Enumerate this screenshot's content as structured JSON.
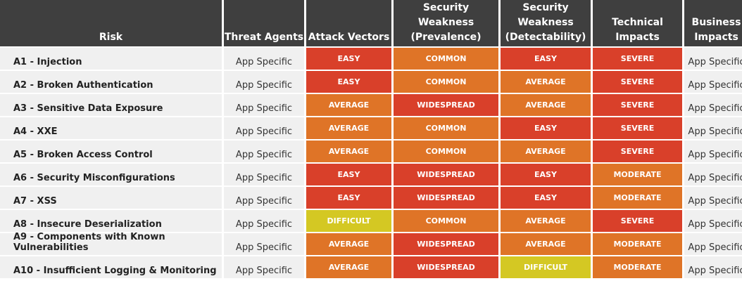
{
  "header": {
    "risk": "Risk",
    "threat_agents": "Threat Agents",
    "attack_vectors": "Attack Vectors",
    "prevalence_line1": "Security Weakness",
    "prevalence_line2": "(Prevalence)",
    "detectability_line1": "Security",
    "detectability_line2": "Weakness",
    "detectability_line3": "(Detectability)",
    "technical_line1": "Technical",
    "technical_line2": "Impacts",
    "business_line1": "Business",
    "business_line2": "Impacts"
  },
  "colors": {
    "red": "#d9402a",
    "orange": "#df7427",
    "yellow": "#d4c823",
    "header_bg": "#3f3f3f",
    "row_bg": "#f0f0f0"
  },
  "rows": [
    {
      "risk": "A1 - Injection",
      "threat": "App Specific",
      "attack": "EASY",
      "prevalence": "COMMON",
      "detectability": "EASY",
      "technical": "SEVERE",
      "business": "App Specific"
    },
    {
      "risk": "A2 - Broken Authentication",
      "threat": "App Specific",
      "attack": "EASY",
      "prevalence": "COMMON",
      "detectability": "AVERAGE",
      "technical": "SEVERE",
      "business": "App Specific"
    },
    {
      "risk": "A3 - Sensitive Data Exposure",
      "threat": "App Specific",
      "attack": "AVERAGE",
      "prevalence": "WIDESPREAD",
      "detectability": "AVERAGE",
      "technical": "SEVERE",
      "business": "App Specific"
    },
    {
      "risk": "A4 - XXE",
      "threat": "App Specific",
      "attack": "AVERAGE",
      "prevalence": "COMMON",
      "detectability": "EASY",
      "technical": "SEVERE",
      "business": "App Specific"
    },
    {
      "risk": "A5 - Broken Access Control",
      "threat": "App Specific",
      "attack": "AVERAGE",
      "prevalence": "COMMON",
      "detectability": "AVERAGE",
      "technical": "SEVERE",
      "business": "App Specific"
    },
    {
      "risk": "A6 - Security Misconfigurations",
      "threat": "App Specific",
      "attack": "EASY",
      "prevalence": "WIDESPREAD",
      "detectability": "EASY",
      "technical": "MODERATE",
      "business": "App Specific"
    },
    {
      "risk": "A7 - XSS",
      "threat": "App Specific",
      "attack": "EASY",
      "prevalence": "WIDESPREAD",
      "detectability": "EASY",
      "technical": "MODERATE",
      "business": "App Specific"
    },
    {
      "risk": "A8 - Insecure Deserialization",
      "threat": "App Specific",
      "attack": "DIFFICULT",
      "prevalence": "COMMON",
      "detectability": "AVERAGE",
      "technical": "SEVERE",
      "business": "App Specific"
    },
    {
      "risk": "A9 - Components with Known Vulnerabilities",
      "threat": "App Specific",
      "attack": "AVERAGE",
      "prevalence": "WIDESPREAD",
      "detectability": "AVERAGE",
      "technical": "MODERATE",
      "business": "App Specific"
    },
    {
      "risk": "A10 - Insufficient Logging & Monitoring",
      "threat": "App Specific",
      "attack": "AVERAGE",
      "prevalence": "WIDESPREAD",
      "detectability": "DIFFICULT",
      "technical": "MODERATE",
      "business": "App Specific"
    }
  ]
}
